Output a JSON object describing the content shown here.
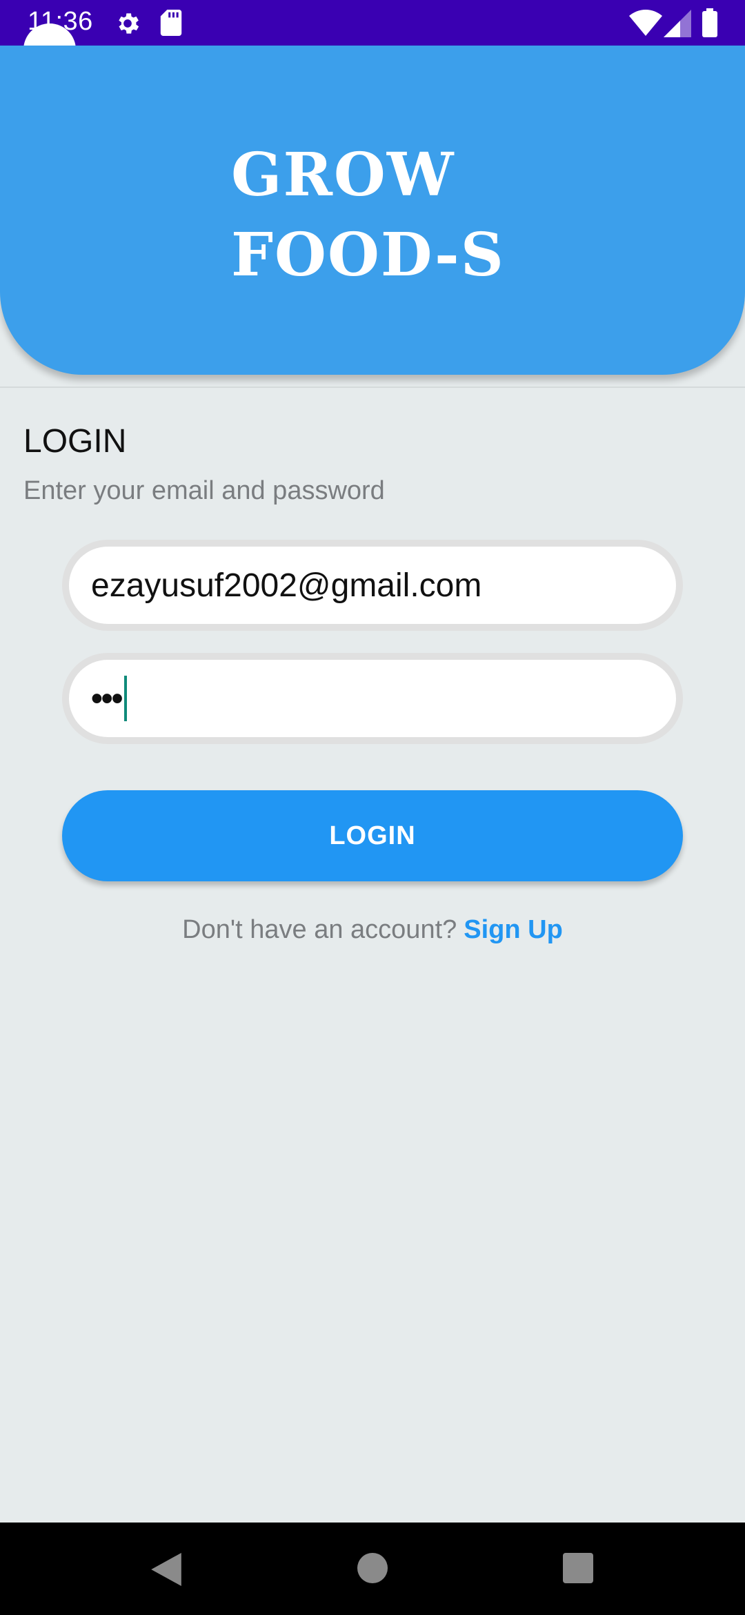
{
  "status_bar": {
    "time": "11:36",
    "icons": [
      "gear-icon",
      "sd-card-icon",
      "wifi-icon",
      "signal-icon",
      "battery-icon"
    ]
  },
  "header": {
    "title_line1": "GROW",
    "title_line2": "FOOD-S",
    "background_color": "#3c9feb"
  },
  "login": {
    "heading": "LOGIN",
    "subtitle": "Enter your email and password",
    "email_value": "ezayusuf2002@gmail.com",
    "password_masked": "•••",
    "button_label": "LOGIN",
    "signup_prompt": "Don't have an account?",
    "signup_link": "Sign Up"
  },
  "colors": {
    "accent": "#2196f3",
    "status_bar": "#3a00b2",
    "background": "#e6ebec"
  },
  "nav_bar": {
    "icons": [
      "back-icon",
      "home-icon",
      "recents-icon"
    ]
  }
}
